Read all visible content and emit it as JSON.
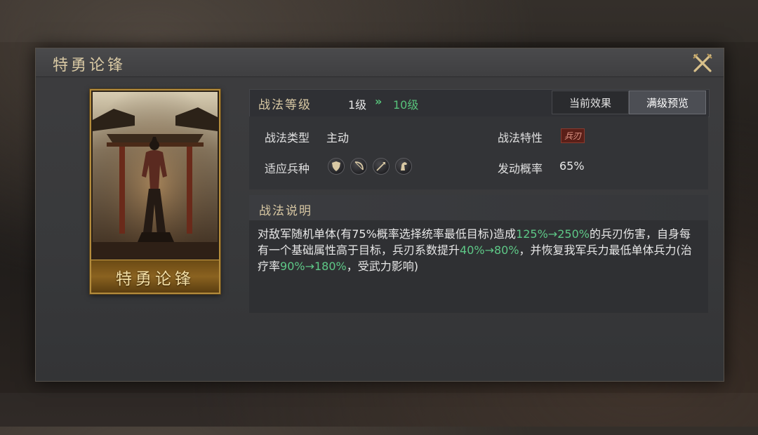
{
  "dialog": {
    "title": "特勇论锋",
    "close_icon": "close-x-icon"
  },
  "card": {
    "name": "特勇论锋",
    "art": "warrior-portrait"
  },
  "level": {
    "label": "战法等级",
    "from": "1级",
    "arrow": "»",
    "to": "10级"
  },
  "tabs": [
    {
      "label": "当前效果",
      "active": false
    },
    {
      "label": "满级预览",
      "active": true
    }
  ],
  "attributes": {
    "type_label": "战法类型",
    "type_value": "主动",
    "trait_label": "战法特性",
    "trait_value": "兵刃",
    "troop_label": "适应兵种",
    "troop_icons": [
      "shield-icon",
      "bow-icon",
      "spear-icon",
      "horse-icon"
    ],
    "chance_label": "发动概率",
    "chance_value": "65%"
  },
  "description": {
    "title": "战法说明",
    "segments": [
      {
        "text": "对敌军随机单体(有75%概率选择统率最低目标)造成",
        "hl": false
      },
      {
        "text": "125%→250%",
        "hl": true
      },
      {
        "text": "的兵刃伤害，自身每有一个基础属性高于目标，兵刃系数提升",
        "hl": false
      },
      {
        "text": "40%→80%",
        "hl": true
      },
      {
        "text": "，并恢复我军兵力最低单体兵力(治疗率",
        "hl": false
      },
      {
        "text": "90%→180%",
        "hl": true
      },
      {
        "text": "，受武力影响)",
        "hl": false
      }
    ]
  },
  "colors": {
    "accent_gold": "#d9c9a4",
    "highlight_green": "#5ec887",
    "trait_red": "#e39a8a"
  }
}
